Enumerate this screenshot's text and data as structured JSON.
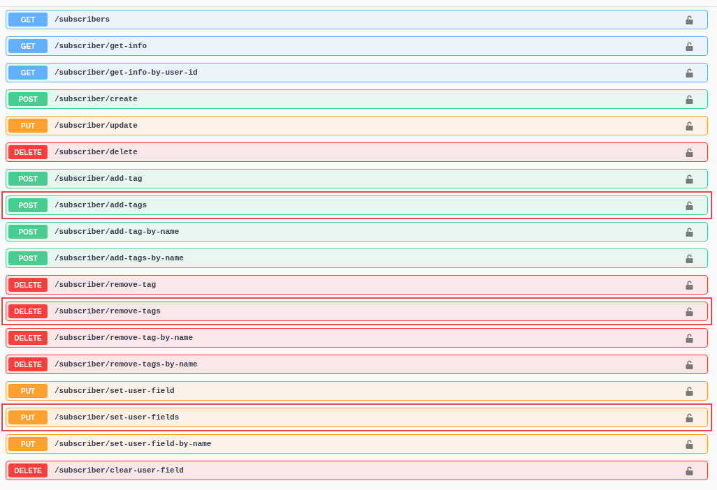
{
  "endpoints": [
    {
      "kind": "get",
      "method": "GET",
      "path": "/subscribers",
      "highlighted": false
    },
    {
      "kind": "get",
      "method": "GET",
      "path": "/subscriber/get-info",
      "highlighted": false
    },
    {
      "kind": "get",
      "method": "GET",
      "path": "/subscriber/get-info-by-user-id",
      "highlighted": false
    },
    {
      "kind": "post",
      "method": "POST",
      "path": "/subscriber/create",
      "highlighted": false
    },
    {
      "kind": "put",
      "method": "PUT",
      "path": "/subscriber/update",
      "highlighted": false
    },
    {
      "kind": "delete",
      "method": "DELETE",
      "path": "/subscriber/delete",
      "highlighted": false
    },
    {
      "kind": "post",
      "method": "POST",
      "path": "/subscriber/add-tag",
      "highlighted": false
    },
    {
      "kind": "post",
      "method": "POST",
      "path": "/subscriber/add-tags",
      "highlighted": true
    },
    {
      "kind": "post",
      "method": "POST",
      "path": "/subscriber/add-tag-by-name",
      "highlighted": false
    },
    {
      "kind": "post",
      "method": "POST",
      "path": "/subscriber/add-tags-by-name",
      "highlighted": false
    },
    {
      "kind": "delete",
      "method": "DELETE",
      "path": "/subscriber/remove-tag",
      "highlighted": false
    },
    {
      "kind": "delete",
      "method": "DELETE",
      "path": "/subscriber/remove-tags",
      "highlighted": true
    },
    {
      "kind": "delete",
      "method": "DELETE",
      "path": "/subscriber/remove-tag-by-name",
      "highlighted": false
    },
    {
      "kind": "delete",
      "method": "DELETE",
      "path": "/subscriber/remove-tags-by-name",
      "highlighted": false
    },
    {
      "kind": "put",
      "method": "PUT",
      "path": "/subscriber/set-user-field",
      "highlighted": false
    },
    {
      "kind": "put",
      "method": "PUT",
      "path": "/subscriber/set-user-fields",
      "highlighted": true
    },
    {
      "kind": "put",
      "method": "PUT",
      "path": "/subscriber/set-user-field-by-name",
      "highlighted": false
    },
    {
      "kind": "delete",
      "method": "DELETE",
      "path": "/subscriber/clear-user-field",
      "highlighted": false
    }
  ]
}
